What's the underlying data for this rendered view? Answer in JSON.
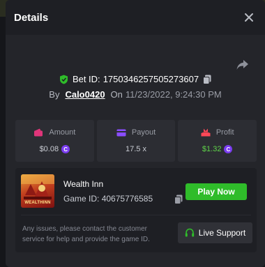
{
  "modal": {
    "title": "Details",
    "close_icon": "close-icon"
  },
  "bet": {
    "id_label": "Bet ID:",
    "id_value": "1750346257505273607",
    "by_label": "By",
    "username": "Calo0420",
    "on_label": "On",
    "datetime": "11/23/2022, 9:24:30 PM"
  },
  "stats": {
    "amount": {
      "label": "Amount",
      "value": "$0.08",
      "icon": "wallet-icon",
      "icon_color": "#e0357a"
    },
    "payout": {
      "label": "Payout",
      "value": "17.5 x",
      "icon": "card-icon",
      "icon_color": "#8a4dff"
    },
    "profit": {
      "label": "Profit",
      "value": "$1.32",
      "icon": "profit-icon",
      "icon_color": "#ff4757",
      "value_color": "#5fd34a"
    }
  },
  "game": {
    "name": "Wealth Inn",
    "id_label": "Game ID:",
    "id_value": "40675776585",
    "thumbnail_text": "WEALTHINN",
    "play_label": "Play Now",
    "play_color": "#2fbc2a"
  },
  "support": {
    "message": "Any issues, please contact the customer service for help and provide the game ID.",
    "button_label": "Live Support"
  },
  "coin_symbol": "C"
}
